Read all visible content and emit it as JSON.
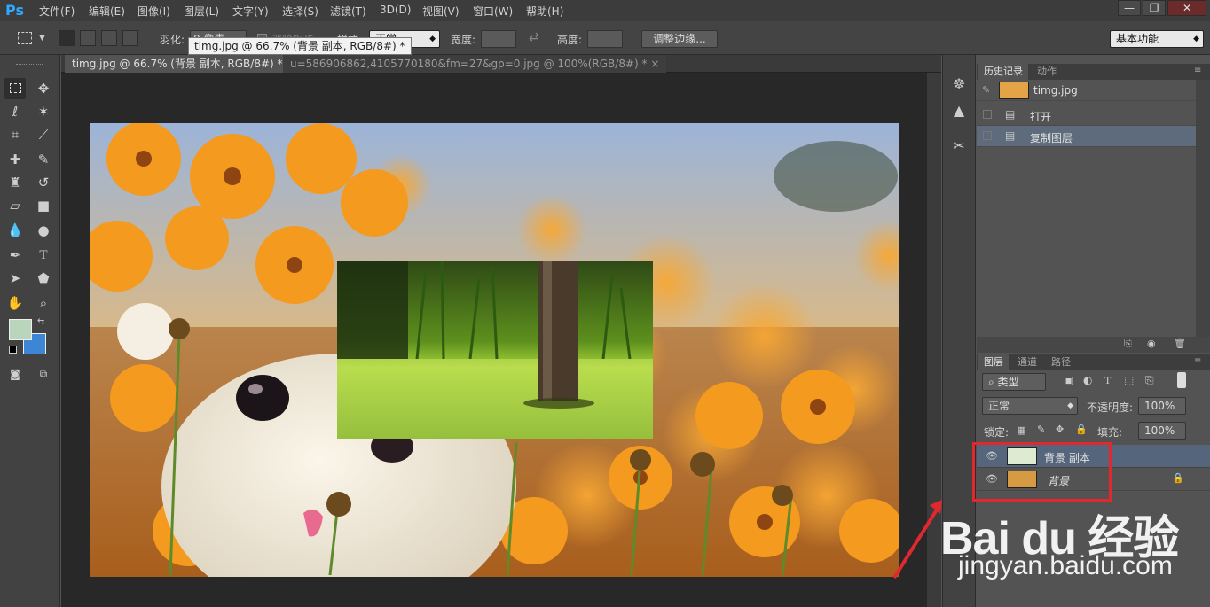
{
  "app": {
    "logo": "Ps"
  },
  "menu": [
    "文件(F)",
    "编辑(E)",
    "图像(I)",
    "图层(L)",
    "文字(Y)",
    "选择(S)",
    "滤镜(T)",
    "3D(D)",
    "视图(V)",
    "窗口(W)",
    "帮助(H)"
  ],
  "window_buttons": [
    "—",
    "❐",
    "✕"
  ],
  "options": {
    "feather_label": "羽化:",
    "feather_value": "0 像素",
    "antialias_label": "消除锯齿",
    "style_label": "样式:",
    "style_value": "正常",
    "width_label": "宽度:",
    "height_label": "高度:",
    "refine_edge": "调整边缘...",
    "workspace": "基本功能"
  },
  "tooltip": "timg.jpg @ 66.7% (背景 副本, RGB/8#) *",
  "tabs": [
    {
      "label": "timg.jpg @ 66.7% (背景 副本, RGB/8#) *",
      "close": "×"
    },
    {
      "label": "u=586906862,4105770180&fm=27&gp=0.jpg @ 100%(RGB/8#) *",
      "close": "×"
    }
  ],
  "history_panel": {
    "tabs": [
      "历史记录",
      "动作"
    ],
    "snapshot": "timg.jpg",
    "items": [
      "打开",
      "复制图层"
    ]
  },
  "layers_panel": {
    "tabs": [
      "图层",
      "通道",
      "路径"
    ],
    "filter_kind": "类型",
    "blend_mode": "正常",
    "opacity_label": "不透明度:",
    "opacity_value": "100%",
    "lock_label": "锁定:",
    "fill_label": "填充:",
    "fill_value": "100%",
    "layers": [
      "背景 副本",
      "背景"
    ]
  },
  "watermark": {
    "logo": "Bai du 经验",
    "url": "jingyan.baidu.com"
  },
  "colors": {
    "accent_red": "#e0282e",
    "foreground": "#b9d6bd",
    "background": "#3d86d6"
  }
}
